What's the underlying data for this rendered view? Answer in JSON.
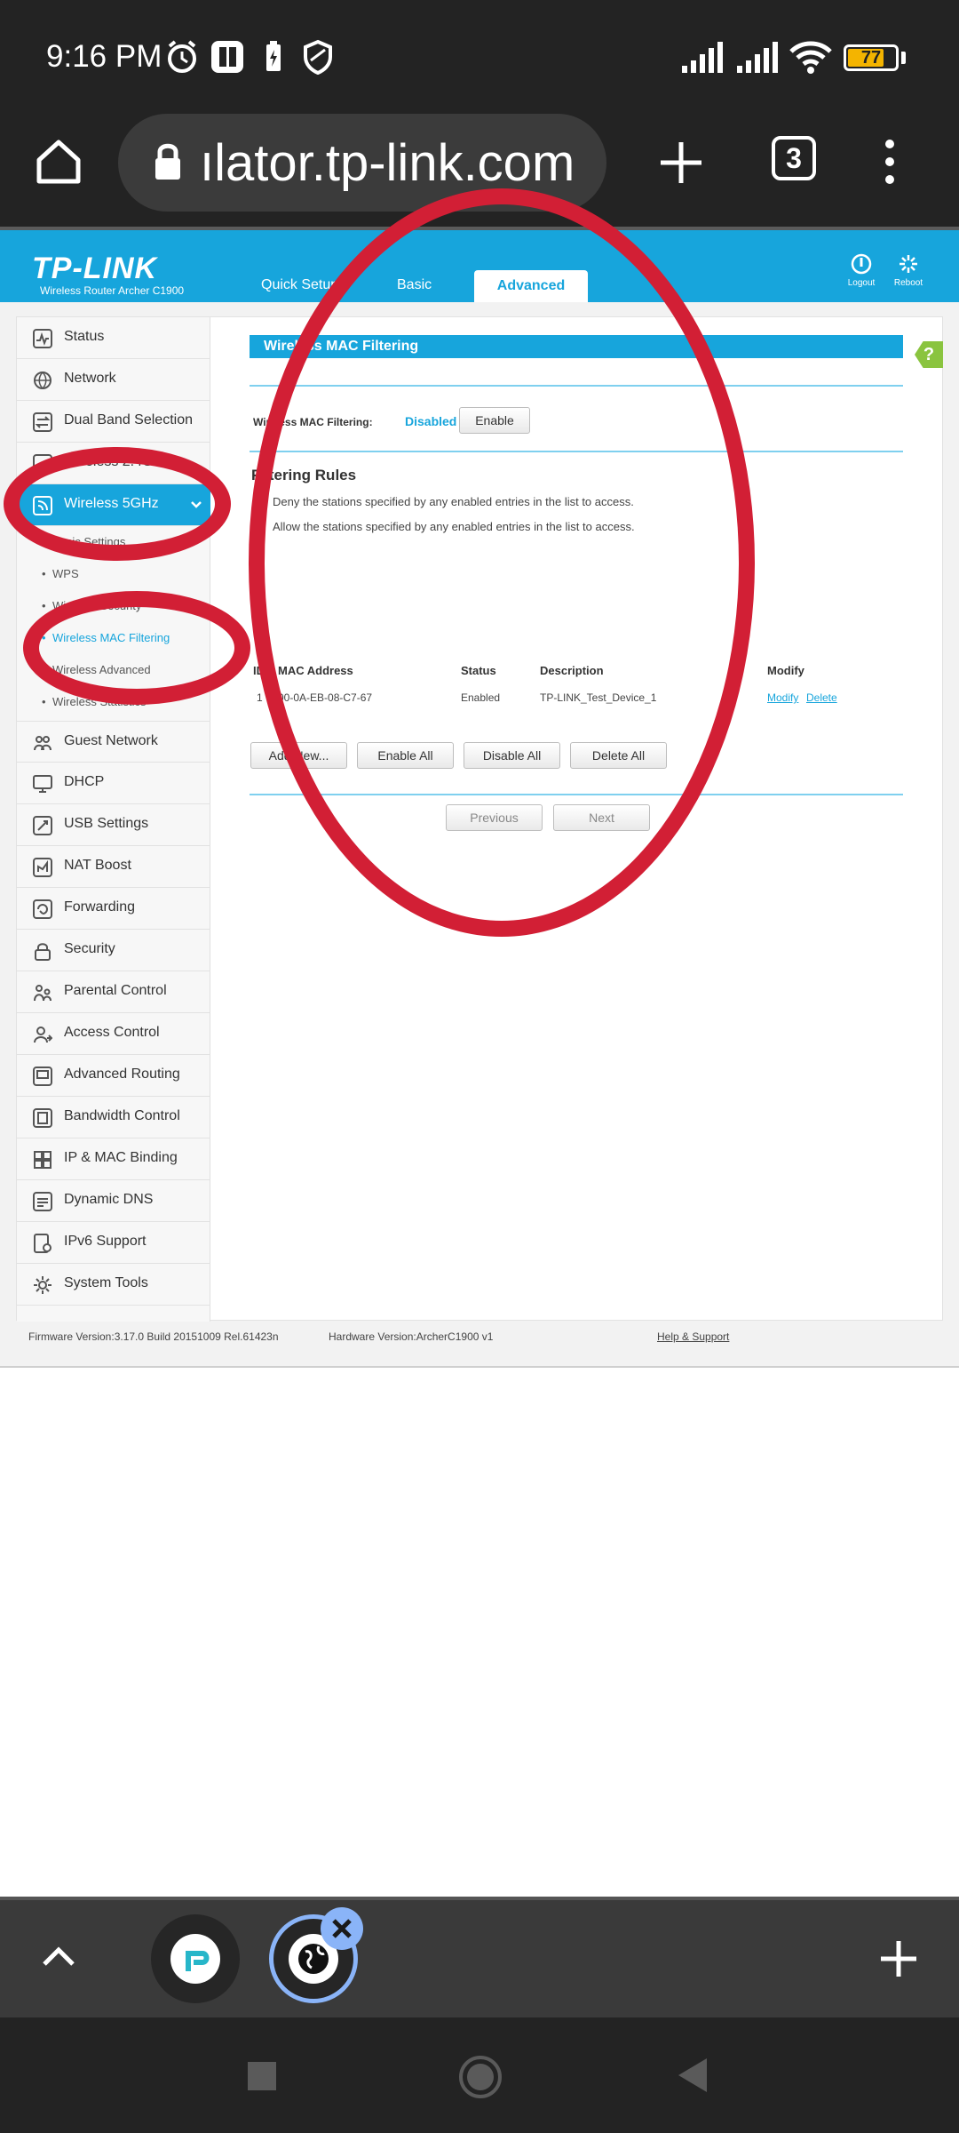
{
  "status_bar": {
    "time": "9:16 PM",
    "battery": "77",
    "battery_level_percent": 77,
    "icons": [
      "alarm-icon",
      "app-icon",
      "charging-icon",
      "shield-icon",
      "signal-icon",
      "signal-icon",
      "wifi-icon",
      "battery-icon"
    ]
  },
  "browser": {
    "url": "ılator.tp-link.com",
    "tab_count": "3",
    "icons": [
      "home-icon",
      "lock-icon",
      "new-tab-icon",
      "tabs-icon",
      "menu-icon"
    ]
  },
  "router": {
    "logo": "TP-LINK",
    "model": "Wireless Router Archer C1900",
    "nav_tabs": [
      "Quick Setup",
      "Basic",
      "Advanced"
    ],
    "active_tab": "Advanced",
    "header_buttons": [
      "Logout",
      "Reboot"
    ],
    "sidebar": [
      {
        "label": "Status",
        "icon": "status-icon"
      },
      {
        "label": "Network",
        "icon": "globe-icon"
      },
      {
        "label": "Dual Band Selection",
        "icon": "dual-band-icon"
      },
      {
        "label": "Wireless 2.4GHz",
        "icon": "wireless-icon"
      },
      {
        "label": "Wireless 5GHz",
        "icon": "wireless-icon"
      },
      {
        "label": "Guest Network",
        "icon": "guest-icon"
      },
      {
        "label": "DHCP",
        "icon": "dhcp-icon"
      },
      {
        "label": "USB Settings",
        "icon": "usb-icon"
      },
      {
        "label": "NAT Boost",
        "icon": "nat-icon"
      },
      {
        "label": "Forwarding",
        "icon": "forwarding-icon"
      },
      {
        "label": "Security",
        "icon": "lock-icon"
      },
      {
        "label": "Parental Control",
        "icon": "parental-icon"
      },
      {
        "label": "Access Control",
        "icon": "access-icon"
      },
      {
        "label": "Advanced Routing",
        "icon": "routing-icon"
      },
      {
        "label": "Bandwidth Control",
        "icon": "bandwidth-icon"
      },
      {
        "label": "IP & MAC Binding",
        "icon": "binding-icon"
      },
      {
        "label": "Dynamic DNS",
        "icon": "dns-icon"
      },
      {
        "label": "IPv6 Support",
        "icon": "ipv6-icon"
      },
      {
        "label": "System Tools",
        "icon": "gear-icon"
      }
    ],
    "sub_items": [
      "Basic Settings",
      "WPS",
      "Wireless Security",
      "Wireless MAC Filtering",
      "Wireless Advanced",
      "Wireless Statistics"
    ],
    "active_sub": "Wireless MAC Filtering",
    "section_title": "Wireless MAC Filtering",
    "filter_label": "Wireless MAC Filtering:",
    "filter_status": "Disabled",
    "enable_button": "Enable",
    "rules_title": "Filtering Rules",
    "rule_deny": "Deny the stations specified by any enabled entries in the list to access.",
    "rule_allow": "Allow the stations specified by any enabled entries in the list to access.",
    "table_headers": [
      "ID",
      "MAC Address",
      "Status",
      "Description",
      "Modify"
    ],
    "rows": [
      {
        "id": "1",
        "mac": "00-0A-EB-08-C7-67",
        "status": "Enabled",
        "description": "TP-LINK_Test_Device_1",
        "modify": "Modify",
        "delete": "Delete"
      }
    ],
    "buttons": [
      "Add New...",
      "Enable All",
      "Disable All",
      "Delete All"
    ],
    "pager": [
      "Previous",
      "Next"
    ],
    "help_icon": "?",
    "footer": {
      "firmware": "Firmware Version:3.17.0 Build 20151009 Rel.61423n",
      "hardware": "Hardware Version:ArcherC1900 v1",
      "help": "Help & Support"
    }
  },
  "bottom_tabs": {
    "icons": [
      "chevron-up-icon",
      "tplink-tab-icon",
      "globe-tab-icon",
      "close-icon",
      "add-tab-icon"
    ]
  },
  "nav_bar": {
    "icons": [
      "recents-icon",
      "home-icon",
      "back-icon"
    ]
  },
  "annotation_color": "#d21f35"
}
